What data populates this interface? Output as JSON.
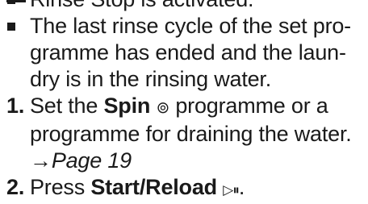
{
  "bullets": [
    {
      "lines": [
        "Rinse Stop is activated."
      ]
    },
    {
      "lines": [
        "The last rinse cycle of the set pro-",
        "gramme has ended and the laun-",
        "dry is in the rinsing water."
      ]
    }
  ],
  "steps": [
    {
      "number": "1.",
      "line1_pre": "Set the ",
      "line1_bold": "Spin",
      "line1_icon": "⊚",
      "line1_post": " programme or a",
      "line2": "programme for draining the water.",
      "link_arrow": "→",
      "link_text": "Page 19"
    },
    {
      "number": "2.",
      "pre": "Press ",
      "bold": "Start/Reload",
      "icon": "▷⏸",
      "post": "."
    }
  ],
  "icons": {
    "spin": "spin-symbol-icon",
    "start_reload": "start-pause-icon"
  }
}
